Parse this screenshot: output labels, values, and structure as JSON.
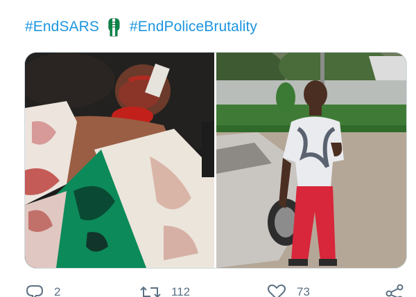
{
  "tweet": {
    "hashtag_1": "#EndSARS",
    "emoji": "raised-fist-nigeria-emoji",
    "hashtag_2": "#EndPoliceBrutality"
  },
  "media": {
    "count": 2,
    "items": [
      {
        "name": "injured-man-photo"
      },
      {
        "name": "young-man-standing-photo"
      }
    ]
  },
  "actions": {
    "reply": {
      "icon": "reply-icon",
      "count": "2"
    },
    "retweet": {
      "icon": "retweet-icon",
      "count": "112"
    },
    "like": {
      "icon": "heart-icon",
      "count": "73"
    },
    "share": {
      "icon": "share-icon"
    }
  },
  "colors": {
    "hashtag": "#1b95e0",
    "action_gray": "#5b7083",
    "nigeria_green": "#008751",
    "border": "#cfd9de"
  }
}
